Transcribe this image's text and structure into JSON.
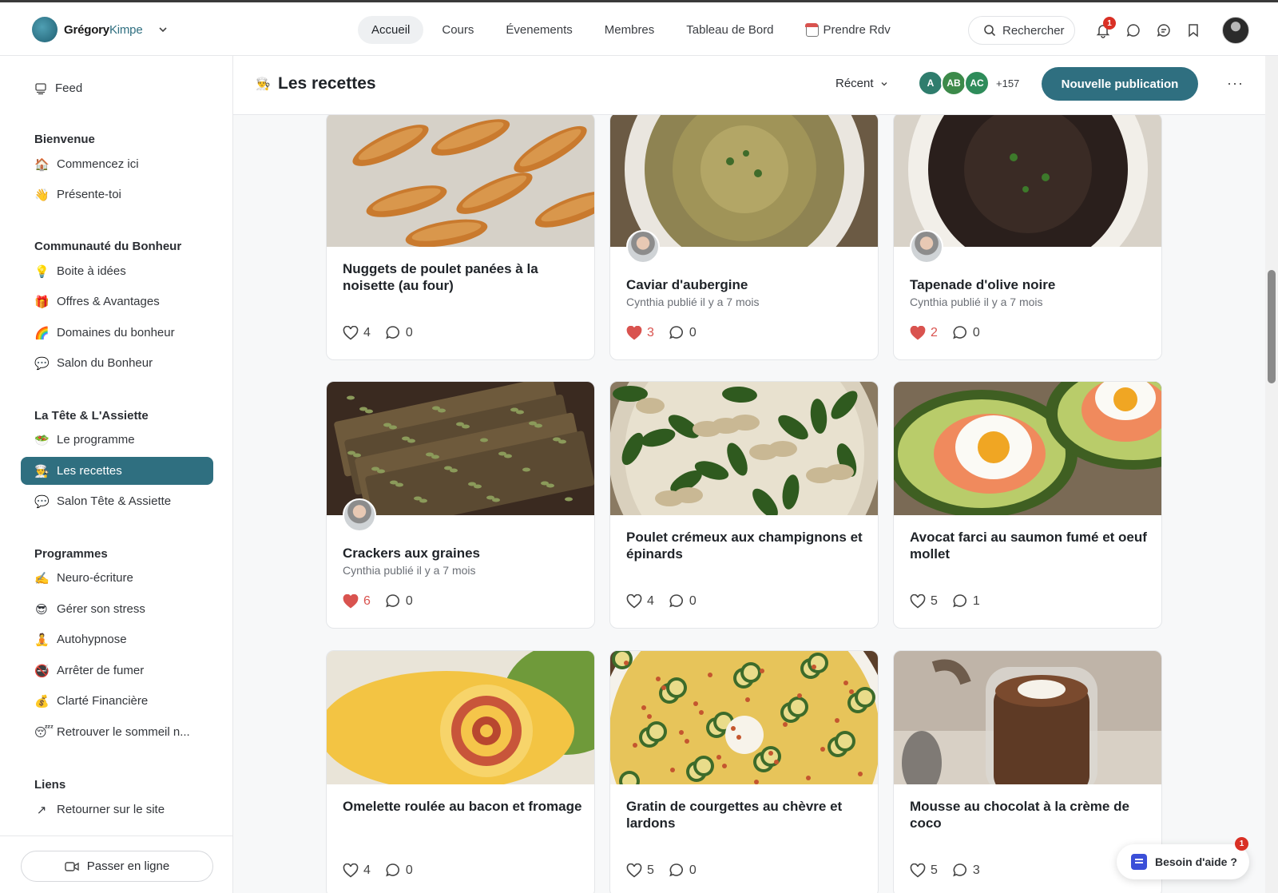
{
  "brand": {
    "name_bold": "Grégory",
    "name_rest": "Kimpe"
  },
  "nav": {
    "items": [
      "Accueil",
      "Cours",
      "Évenements",
      "Membres",
      "Tableau de Bord",
      "Prendre Rdv"
    ],
    "active": "Accueil"
  },
  "search": {
    "label": "Rechercher"
  },
  "notifications": {
    "count": "1"
  },
  "sidebar": {
    "feed": "Feed",
    "sections": [
      {
        "heading": "Bienvenue",
        "items": [
          {
            "icon": "🏠",
            "label": "Commencez ici"
          },
          {
            "icon": "👋",
            "label": "Présente-toi"
          }
        ]
      },
      {
        "heading": "Communauté du Bonheur",
        "items": [
          {
            "icon": "💡",
            "label": "Boite à idées"
          },
          {
            "icon": "🎁",
            "label": "Offres & Avantages"
          },
          {
            "icon": "🌈",
            "label": "Domaines du bonheur"
          },
          {
            "icon": "💬",
            "label": "Salon du Bonheur"
          }
        ]
      },
      {
        "heading": "La Tête & L'Assiette",
        "items": [
          {
            "icon": "🥗",
            "label": "Le programme"
          },
          {
            "icon": "👨‍🍳",
            "label": "Les recettes"
          },
          {
            "icon": "💬",
            "label": "Salon Tête & Assiette"
          }
        ]
      },
      {
        "heading": "Programmes",
        "items": [
          {
            "icon": "✍️",
            "label": "Neuro-écriture"
          },
          {
            "icon": "😎",
            "label": "Gérer son stress"
          },
          {
            "icon": "🧘",
            "label": "Autohypnose"
          },
          {
            "icon": "🚭",
            "label": "Arrêter de fumer"
          },
          {
            "icon": "💰",
            "label": "Clarté Financière"
          },
          {
            "icon": "😴",
            "label": "Retrouver le sommeil n..."
          }
        ]
      },
      {
        "heading": "Liens",
        "items": [
          {
            "icon": "↗",
            "label": "Retourner sur le site"
          }
        ]
      }
    ],
    "active_item": "Les recettes",
    "section_actions": {
      "more": "···",
      "add": "+"
    },
    "live_button": "Passer en ligne"
  },
  "space": {
    "icon": "👨‍🍳",
    "title": "Les recettes",
    "sort_label": "Récent",
    "members": [
      {
        "initials": "A",
        "color": "#2f7d6d"
      },
      {
        "initials": "AB",
        "color": "#3c8a4a"
      },
      {
        "initials": "AC",
        "color": "#2e8c5a"
      }
    ],
    "members_more": "+157",
    "new_post": "Nouvelle publication",
    "more": "···"
  },
  "posts": [
    {
      "title": "Nuggets de poulet panées à la noisette (au four)",
      "meta": "",
      "likes": "4",
      "comments": "0",
      "liked": false,
      "has_avatar": false,
      "image": "nuggets"
    },
    {
      "title": "Caviar d'aubergine",
      "meta": "Cynthia publié il y a 7 mois",
      "likes": "3",
      "comments": "0",
      "liked": true,
      "has_avatar": true,
      "image": "caviar"
    },
    {
      "title": "Tapenade d'olive noire",
      "meta": "Cynthia publié il y a 7 mois",
      "likes": "2",
      "comments": "0",
      "liked": true,
      "has_avatar": true,
      "image": "tapenade"
    },
    {
      "title": "Crackers aux graines",
      "meta": "Cynthia publié il y a 7 mois",
      "likes": "6",
      "comments": "0",
      "liked": true,
      "has_avatar": true,
      "image": "crackers"
    },
    {
      "title": "Poulet crémeux aux champignons et épinards",
      "meta": "",
      "likes": "4",
      "comments": "0",
      "liked": false,
      "has_avatar": false,
      "image": "poulet"
    },
    {
      "title": "Avocat farci au saumon fumé et oeuf mollet",
      "meta": "",
      "likes": "5",
      "comments": "1",
      "liked": false,
      "has_avatar": false,
      "image": "avocat"
    },
    {
      "title": "Omelette roulée au bacon et fromage",
      "meta": "",
      "likes": "4",
      "comments": "0",
      "liked": false,
      "has_avatar": false,
      "image": "omelette"
    },
    {
      "title": "Gratin de courgettes au chèvre et lardons",
      "meta": "",
      "likes": "5",
      "comments": "0",
      "liked": false,
      "has_avatar": false,
      "image": "gratin"
    },
    {
      "title": "Mousse au chocolat à la crème de coco",
      "meta": "",
      "likes": "5",
      "comments": "3",
      "liked": false,
      "has_avatar": false,
      "image": "mousse"
    }
  ],
  "help": {
    "label": "Besoin d'aide ?",
    "badge": "1"
  },
  "colors": {
    "accent": "#2f6f80",
    "like": "#d9534f",
    "badge": "#d93025"
  }
}
